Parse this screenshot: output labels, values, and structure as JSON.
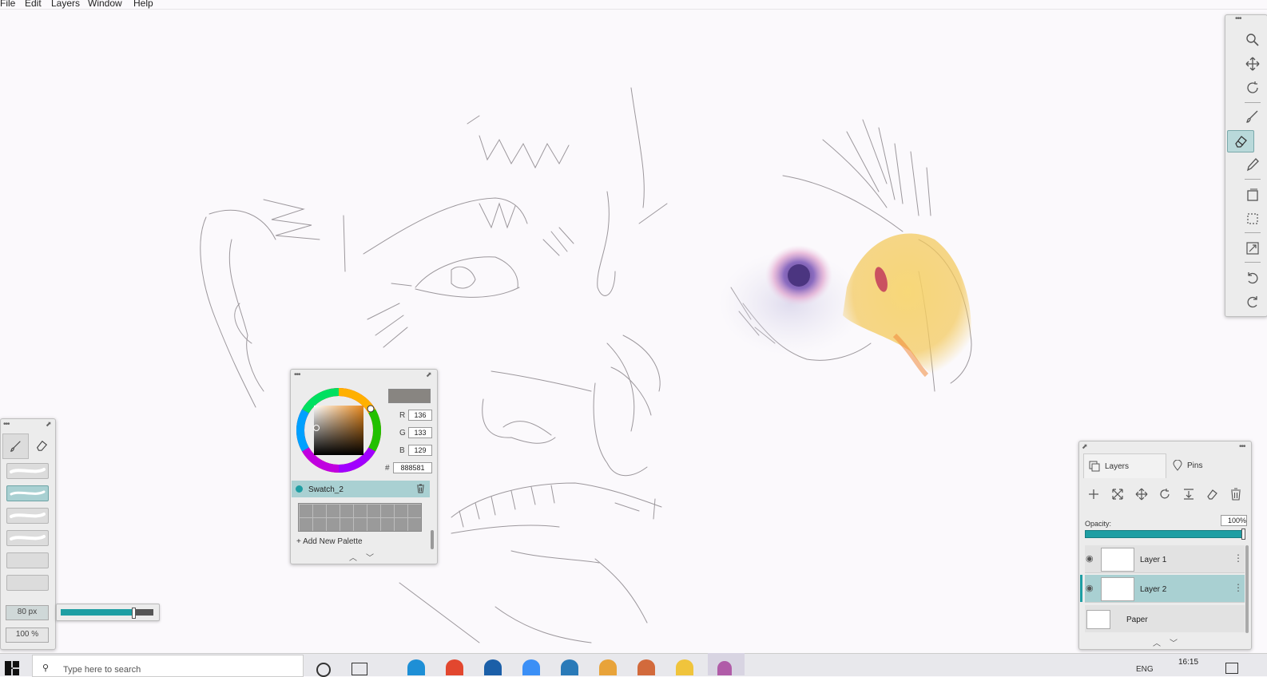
{
  "menu": [
    "File",
    "Edit",
    "Layers",
    "Window",
    "Help"
  ],
  "right_toolbar": {
    "tools": [
      "zoom-icon",
      "move-icon",
      "rotate-icon",
      "brush-icon",
      "eraser-icon",
      "eyedropper-icon",
      "transform-icon",
      "selection-icon",
      "canvas-resize-icon",
      "undo-icon",
      "redo-icon"
    ],
    "selected": "eraser-icon"
  },
  "brush_panel": {
    "size": "80 px",
    "opacity": "100 %",
    "size_slider_fraction": 0.78,
    "accent": "#1e9ea3"
  },
  "color_panel": {
    "r": "136",
    "g": "133",
    "b": "129",
    "r_label": "R",
    "g_label": "G",
    "b_label": "B",
    "hash_label": "#",
    "hex": "888581",
    "current_color": "#888581",
    "swatch_name": "Swatch_2",
    "add_palette": "+ Add New Palette"
  },
  "layers_panel": {
    "tab_layers": "Layers",
    "tab_pins": "Pins",
    "opacity_label": "Opacity:",
    "opacity_value": "100%",
    "layers": [
      {
        "name": "Layer 1",
        "selected": false
      },
      {
        "name": "Layer 2",
        "selected": true
      }
    ],
    "paper": "Paper"
  },
  "taskbar": {
    "search_placeholder": "Type here to search",
    "lang": "ENG",
    "time": "16:15"
  }
}
